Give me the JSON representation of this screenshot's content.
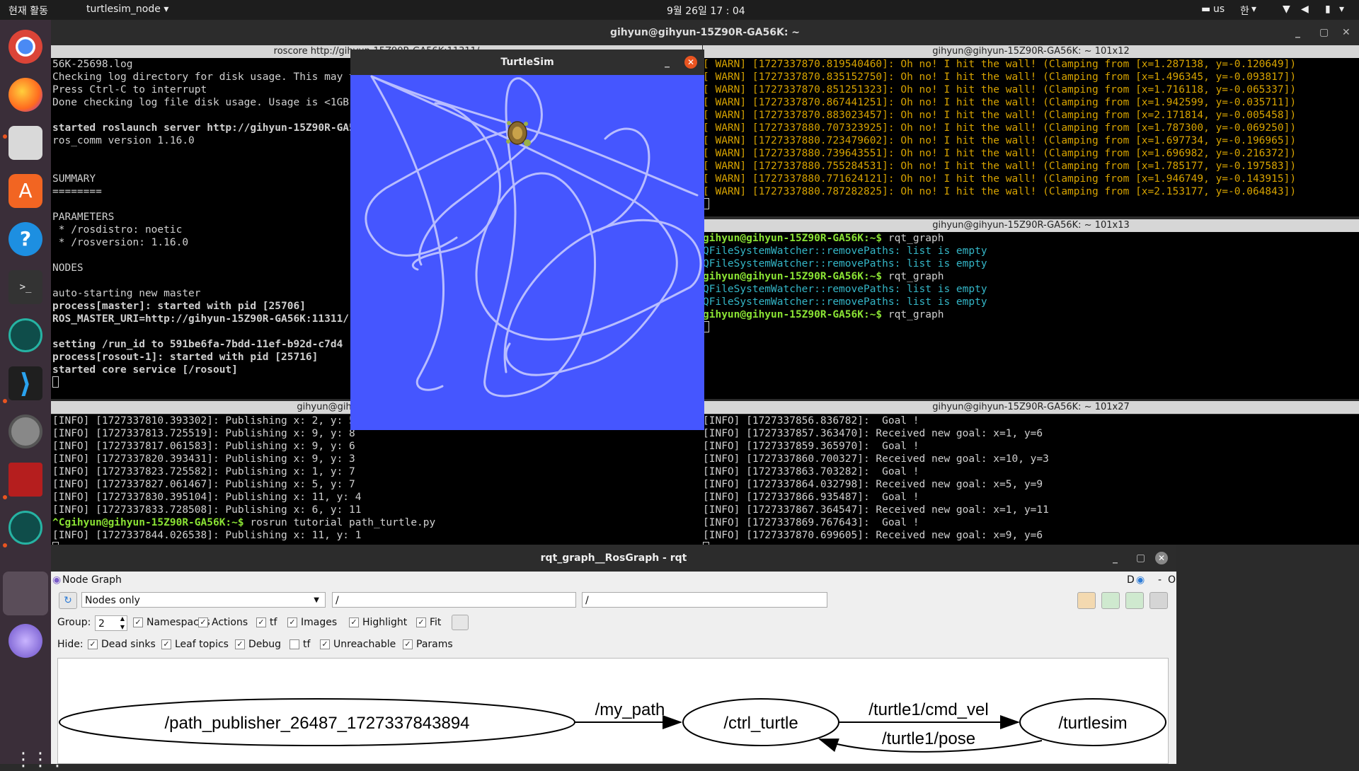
{
  "topbar": {
    "activities": "현재 활동",
    "app_name": "turtlesim_node",
    "clock": "9월 26일  17 : 04",
    "keyboard": "us",
    "ime": "한"
  },
  "dock": [
    "chrome-icon",
    "firefox-icon",
    "files-icon",
    "software-icon",
    "help-icon",
    "terminal-icon",
    "gitkraken-icon",
    "vscode-icon",
    "settings-icon",
    "terminator-icon",
    "gitkraken2-icon",
    "rqt-icon",
    "unity-icon",
    "apps-grid-icon"
  ],
  "terminal": {
    "window_title": "gihyun@gihyun-15Z90R-GA56K: ~",
    "pane_tl_title": "roscore http://gihyun-15Z90R-GA56K:11311/",
    "pane_tr_title": "gihyun@gihyun-15Z90R-GA56K: ~ 101x12",
    "pane_mr_title": "gihyun@gihyun-15Z90R-GA56K: ~ 101x13",
    "pane_bl_title": "gihyun@gihyun-15Z90R-GA56K: ~",
    "pane_br_title": "gihyun@gihyun-15Z90R-GA56K: ~ 101x27",
    "pane_tl_lines": [
      "56K-25698.log",
      "Checking log directory for disk usage. This may take a while.",
      "Press Ctrl-C to interrupt",
      "Done checking log file disk usage. Usage is <1GB.",
      "",
      "started roslaunch server http://gihyun-15Z90R-GA56K:",
      "ros_comm version 1.16.0",
      "",
      "",
      "SUMMARY",
      "========",
      "",
      "PARAMETERS",
      " * /rosdistro: noetic",
      " * /rosversion: 1.16.0",
      "",
      "NODES",
      "",
      "auto-starting new master",
      "process[master]: started with pid [25706]",
      "ROS_MASTER_URI=http://gihyun-15Z90R-GA56K:11311/",
      "",
      "setting /run_id to 591be6fa-7bdd-11ef-b92d-c7d4",
      "process[rosout-1]: started with pid [25716]",
      "started core service [/rosout]"
    ],
    "pane_tr_lines": [
      "[ WARN] [1727337870.819540460]: Oh no! I hit the wall! (Clamping from [x=1.287138, y=-0.120649])",
      "[ WARN] [1727337870.835152750]: Oh no! I hit the wall! (Clamping from [x=1.496345, y=-0.093817])",
      "[ WARN] [1727337870.851251323]: Oh no! I hit the wall! (Clamping from [x=1.716118, y=-0.065337])",
      "[ WARN] [1727337870.867441251]: Oh no! I hit the wall! (Clamping from [x=1.942599, y=-0.035711])",
      "[ WARN] [1727337870.883023457]: Oh no! I hit the wall! (Clamping from [x=2.171814, y=-0.005458])",
      "[ WARN] [1727337880.707323925]: Oh no! I hit the wall! (Clamping from [x=1.787300, y=-0.069250])",
      "[ WARN] [1727337880.723479602]: Oh no! I hit the wall! (Clamping from [x=1.697734, y=-0.196965])",
      "[ WARN] [1727337880.739643551]: Oh no! I hit the wall! (Clamping from [x=1.696982, y=-0.216372])",
      "[ WARN] [1727337880.755284531]: Oh no! I hit the wall! (Clamping from [x=1.785177, y=-0.197583])",
      "[ WARN] [1727337880.771624121]: Oh no! I hit the wall! (Clamping from [x=1.946749, y=-0.143915])",
      "[ WARN] [1727337880.787282825]: Oh no! I hit the wall! (Clamping from [x=2.153177, y=-0.064843])"
    ],
    "pane_mr_lines": [
      {
        "text": "gihyun@gihyun-15Z90R-GA56K:~$ rqt_graph",
        "cls": "prompt"
      },
      {
        "text": "QFileSystemWatcher::removePaths: list is empty",
        "cls": "cyan"
      },
      {
        "text": "QFileSystemWatcher::removePaths: list is empty",
        "cls": "cyan"
      },
      {
        "text": "gihyun@gihyun-15Z90R-GA56K:~$ rqt_graph",
        "cls": "prompt"
      },
      {
        "text": "QFileSystemWatcher::removePaths: list is empty",
        "cls": "cyan"
      },
      {
        "text": "QFileSystemWatcher::removePaths: list is empty",
        "cls": "cyan"
      },
      {
        "text": "gihyun@gihyun-15Z90R-GA56K:~$ rqt_graph",
        "cls": "prompt"
      }
    ],
    "pane_bl_lines": [
      "[INFO] [1727337810.393302]: Publishing x: 2, y: 5",
      "[INFO] [1727337813.725519]: Publishing x: 9, y: 8",
      "[INFO] [1727337817.061583]: Publishing x: 9, y: 6",
      "[INFO] [1727337820.393431]: Publishing x: 9, y: 3",
      "[INFO] [1727337823.725582]: Publishing x: 1, y: 7",
      "[INFO] [1727337827.061467]: Publishing x: 5, y: 7",
      "[INFO] [1727337830.395104]: Publishing x: 11, y: 4",
      "[INFO] [1727337833.728508]: Publishing x: 6, y: 11",
      "^Cgihyun@gihyun-15Z90R-GA56K:~$ rosrun tutorial path_turtle.py",
      "[INFO] [1727337844.026538]: Publishing x: 11, y: 1"
    ],
    "pane_br_lines": [
      "[INFO] [1727337856.836782]:  Goal !",
      "[INFO] [1727337857.363470]: Received new goal: x=1, y=6",
      "[INFO] [1727337859.365970]:  Goal !",
      "[INFO] [1727337860.700327]: Received new goal: x=10, y=3",
      "[INFO] [1727337863.703282]:  Goal !",
      "[INFO] [1727337864.032798]: Received new goal: x=5, y=9",
      "[INFO] [1727337866.935487]:  Goal !",
      "[INFO] [1727337867.364547]: Received new goal: x=1, y=11",
      "[INFO] [1727337869.767643]:  Goal !",
      "[INFO] [1727337870.699605]: Received new goal: x=9, y=6"
    ]
  },
  "turtlesim": {
    "title": "TurtleSim",
    "bg_color": "#4556ff",
    "path_color": "#b3b8ff"
  },
  "rqt": {
    "title": "rqt_graph__RosGraph - rqt",
    "plugin_label": "Node Graph",
    "plugin_ctrl": "D",
    "dropdown_value": "Nodes only",
    "filter1": "/",
    "filter2": "/",
    "group_label": "Group:",
    "group_value": "2",
    "namespaces": "Namespaces",
    "actions": "Actions",
    "tf": "tf",
    "images": "Images",
    "highlight": "Highlight",
    "fit": "Fit",
    "hide_label": "Hide:",
    "dead_sinks": "Dead sinks",
    "leaf_topics": "Leaf topics",
    "debug": "Debug",
    "tf_hide": "tf",
    "unreachable": "Unreachable",
    "params": "Params",
    "nodes": {
      "path_publisher": "/path_publisher_26487_1727337843894",
      "ctrl_turtle": "/ctrl_turtle",
      "turtlesim": "/turtlesim"
    },
    "edges": {
      "my_path": "/my_path",
      "cmd_vel": "/turtle1/cmd_vel",
      "pose": "/turtle1/pose"
    }
  }
}
